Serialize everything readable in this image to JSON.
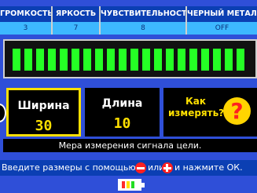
{
  "settings": [
    {
      "label": "ГРОМКОСТЬ",
      "value": "3"
    },
    {
      "label": "ЯРКОСТЬ",
      "value": "7"
    },
    {
      "label": "ЧУВСТВИТЕЛЬНОСТЬ",
      "value": "8"
    },
    {
      "label": "ЧЕРНЫЙ МЕТАЛЛ",
      "value": "OFF"
    }
  ],
  "signal_bar": {
    "segments_lit": 20,
    "segments_total": 20,
    "color": "#25ff25"
  },
  "panels": {
    "width": {
      "title": "Ширина",
      "value": "30"
    },
    "length": {
      "title": "Длина",
      "value": "10"
    },
    "help": {
      "line1": "Как",
      "line2": "измерять?",
      "icon": "?"
    }
  },
  "description": "Мера измерения сигнала цели.",
  "hint": {
    "part1": "Введите размеры с помощью",
    "part2": "или",
    "part3": "и нажмите ОК."
  },
  "battery": {
    "level_segments": 3,
    "colors": [
      "#ff2a2a",
      "#ffe000",
      "#22dd22"
    ]
  }
}
